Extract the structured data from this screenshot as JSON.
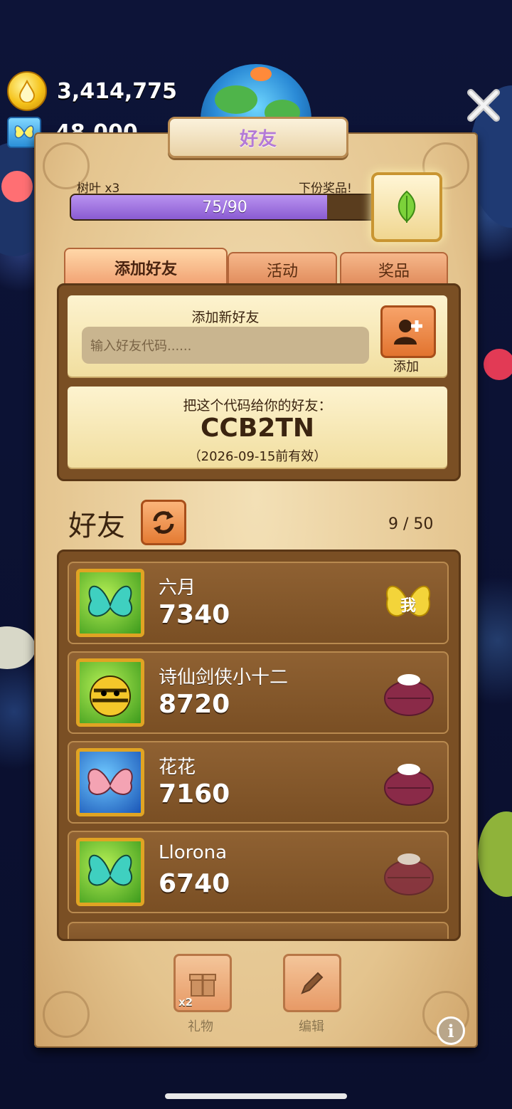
{
  "header": {
    "coins": "3,414,775",
    "butterflies": "48,000",
    "title": "好友"
  },
  "progress": {
    "left_label": "树叶 x3",
    "right_label": "下份奖品!",
    "value_text": "75/90",
    "fraction": 0.8333,
    "reward_icon": "leaf-icon"
  },
  "tabs": [
    {
      "label": "添加好友",
      "active": true
    },
    {
      "label": "活动",
      "active": false
    },
    {
      "label": "奖品",
      "active": false
    }
  ],
  "add_friend": {
    "title": "添加新好友",
    "placeholder": "输入好友代码......",
    "button_label": "添加"
  },
  "share": {
    "title": "把这个代码给你的好友：",
    "code": "CCB2TN",
    "valid": "（2026-09-15前有效）"
  },
  "friends": {
    "heading": "好友",
    "count": "9 / 50",
    "list": [
      {
        "name": "六月",
        "score": "7340",
        "avatar": "butterfly",
        "badge": "我"
      },
      {
        "name": "诗仙剑侠小十二",
        "score": "8720",
        "avatar": "bee",
        "badge": "gift"
      },
      {
        "name": "花花",
        "score": "7160",
        "avatar": "moth",
        "badge": "gift"
      },
      {
        "name": "Llorona",
        "score": "6740",
        "avatar": "butterfly",
        "badge": "gift"
      }
    ]
  },
  "bottom": {
    "gift_label": "礼物",
    "gift_count": "x2",
    "edit_label": "编辑"
  },
  "colors": {
    "progress_fill": "#8a5bd2",
    "accent_orange": "#e2742f",
    "panel_brown": "#7a4f24"
  }
}
